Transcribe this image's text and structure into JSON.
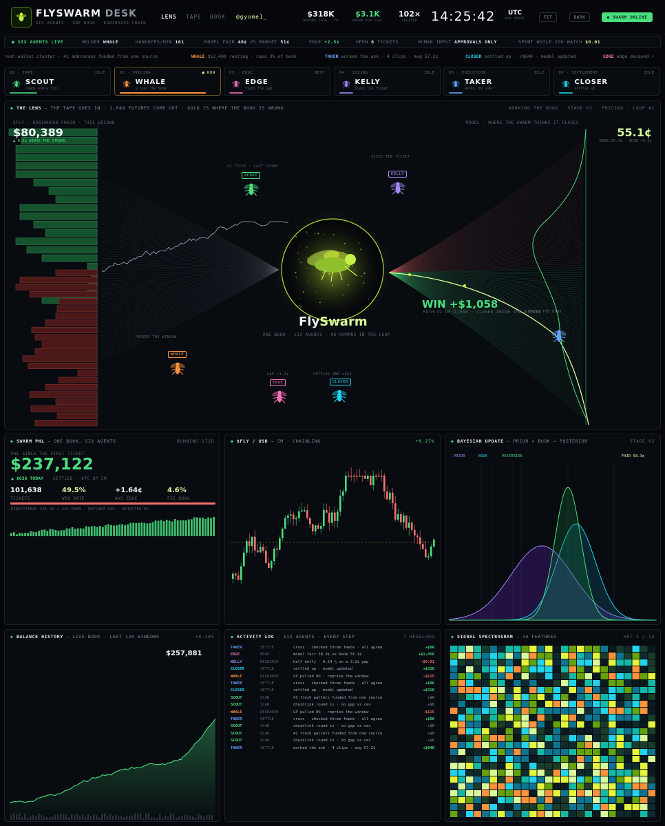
{
  "header": {
    "brand_main": "FLYSWARM",
    "brand_sub": "DESK",
    "tagline": "SIX AGENTS · ONE BOOK · ROBINHOOD CHAIN",
    "nav": [
      "LENS",
      "TAPE",
      "BOOK"
    ],
    "nav_active": "LENS",
    "user": "@gyome1_",
    "stats": [
      {
        "value": "$318K",
        "label": "HUMANS 265% · YR",
        "color": "#f1f4f7"
      },
      {
        "value": "$3.1K",
        "label": "SWARM RUN COST",
        "color": "#4ade80"
      },
      {
        "value": "102×",
        "label": "CHEAPER",
        "color": "#f1f4f7"
      }
    ],
    "clock": "14:25:42",
    "tz": "UTC",
    "tz_sub": "WIN PRIDE",
    "buttons": {
      "fit": "FIT",
      "dark": "DARK",
      "online": "● SWARM ONLINE"
    }
  },
  "status_bar": {
    "live": "● SIX AGENTS LIVE",
    "holder_label": "HOLDER",
    "holder_value": "WHALE",
    "handoffs_label": "HANDOFFS/MIN",
    "handoffs_value": "161",
    "fair_label": "MODEL FAIR",
    "fair_value": "48¢",
    "vs": "VS MARKET",
    "market_value": "51¢",
    "edge_label": "EDGE",
    "edge_value": "+2.5¢",
    "open_label": "OPEN",
    "open_value": "6",
    "open_suffix": "TICKETS",
    "human_label": "HUMAN INPUT",
    "human_value": "APPROVALS ONLY",
    "spent_label": "SPENT WHILE YOU WATCH",
    "spent_value": "$0.01"
  },
  "ticker": [
    {
      "tag": "",
      "text": "resh wallet cluster · 41 addresses funded from one source",
      "color": "#6b7580"
    },
    {
      "tag": "WHALE",
      "text": "$12,400 resting · caps 3% of book",
      "color": "#fb923c"
    },
    {
      "tag": "TAKER",
      "text": "worked the ask · 4 clips · avg 57.2¢",
      "color": "#60a5fa"
    },
    {
      "tag": "CLOSER",
      "text": "settled up · +$640 · model updated",
      "color": "#22d3ee"
    },
    {
      "tag": "EDGE",
      "text": "edge decayed +",
      "color": "#f472b6"
    }
  ],
  "stages": [
    {
      "num": "01 · TAPE",
      "status": "IDLE",
      "name": "SCOUT",
      "desc": "reads every fill",
      "color": "#4ade80",
      "icon": "scout-fly-icon"
    },
    {
      "num": "02 · PRICING",
      "status": "● RUN",
      "name": "WHALE",
      "desc": "prices the book",
      "color": "#fb923c",
      "icon": "whale-fly-icon"
    },
    {
      "num": "03 · EDGE",
      "status": "NEXT",
      "name": "EDGE",
      "desc": "finds the gap",
      "color": "#f472b6",
      "icon": "edge-fly-icon"
    },
    {
      "num": "04 · SIZING",
      "status": "IDLE",
      "name": "KELLY",
      "desc": "sizes the ticket",
      "color": "#a78bfa",
      "icon": "kelly-fly-icon"
    },
    {
      "num": "05 · EXECUTION",
      "status": "IDLE",
      "name": "TAKER",
      "desc": "works the ask",
      "color": "#60a5fa",
      "icon": "taker-fly-icon"
    },
    {
      "num": "06 · SETTLEMENT",
      "status": "IDLE",
      "name": "CLOSER",
      "desc": "settles up",
      "color": "#22d3ee",
      "icon": "closer-fly-icon"
    }
  ],
  "lens": {
    "title": "THE LENS",
    "subtitle": "— THE TAPE GOES IN · 2,048 FUTURES COME OUT · GOLD IS WHERE THE BOOK IS WRONG",
    "status": "WORKING THE BOOK · STAGE 02 · PRICING · LOOP #2",
    "price_label": "$FLY · ROBINHOOD CHAIN · THIS SECOND",
    "price": "$80,389",
    "price_sub": "▲ 0.5¢ ABOVE THE STRIKE",
    "model_label": "MODEL · WHERE THE SWARM THINKS IT CLOSES",
    "model_value": "55.1¢",
    "model_sub": "BOOK 55.1¢ · EDGE +3.2¢",
    "center_title_a": "Fly",
    "center_title_b": "Swarm",
    "center_sub": "ONE BOOK · SIX AGENTS · 96 HUMANS IN THE LOOP",
    "win": "WIN +$1,058",
    "win_sub": "PATH 41 OF 2,048 · CLOSED ABOVE THE STRIKE",
    "flies": [
      {
        "tag": "SCOUT",
        "caption": "41 TICKS · LAST STORE",
        "color": "#4ade80"
      },
      {
        "tag": "KELLY",
        "caption": "SIZES THE TICKET",
        "color": "#a78bfa"
      },
      {
        "tag": "WHALE",
        "caption": "PRICES THE WINDOW",
        "color": "#fb923c"
      },
      {
        "tag": "EDGE",
        "caption": "GAP +3.2¢",
        "color": "#f472b6"
      },
      {
        "tag": "CLOSER",
        "caption": "SETTLES AND LOGS",
        "color": "#22d3ee"
      },
      {
        "tag": "",
        "caption": "WORKS THE BOOK",
        "color": "#60a5fa"
      }
    ]
  },
  "pnl": {
    "title": "SWARM PNL",
    "subtitle": "— ONE BOOK, SIX AGENTS",
    "status": "RUNNING 171D",
    "since": "PNL SINCE THE FIRST TICKET",
    "value": "$237,122",
    "today": "▲ $636 TODAY",
    "today_sub": "SETTLED · 87C UP 5M",
    "stats": [
      {
        "value": "101,638",
        "label": "TICKETS",
        "color": "#f1f4f7"
      },
      {
        "value": "49.5%",
        "label": "WIN RATE",
        "color": "#d9f99d"
      },
      {
        "value": "+1.64¢",
        "label": "AVG EDGE",
        "color": "#f1f4f7"
      },
      {
        "value": "4.6%",
        "label": "FEE DRAG",
        "color": "#d9f99d"
      }
    ],
    "breakdown": "DIRECTIONAL 56% UP / 44% DOWN · MATCHED 92% · REJECTED 8%"
  },
  "fly_chart": {
    "title": "$FLY / USD",
    "subtitle": "— 5M · CHAINLINK",
    "change": "+0.27%"
  },
  "bayes": {
    "title": "BAYESIAN UPDATE",
    "subtitle": "— PRIOR × BOOK → POSTERIOR",
    "status": "STAGE 02",
    "legend": [
      "PRIOR",
      "BOOK",
      "POSTERIOR"
    ],
    "fair": "FAIR 58.3¢"
  },
  "balance": {
    "title": "BALANCE HISTORY",
    "subtitle": "— LIVE BOOK · LAST 120 WINDOWS",
    "change": "+8.38%",
    "value": "$257,881"
  },
  "log": {
    "title": "ACTIVITY LOG",
    "subtitle": "— SIX AGENTS · EVERY STEP",
    "status": "7 RESOLVED",
    "rows": [
      {
        "agent": "TAKER",
        "act": "SETTLE",
        "msg": "cross · checked three feeds · all agree",
        "val": "+$96",
        "c": "#60a5fa",
        "vc": "#4ade80"
      },
      {
        "agent": "EDGE",
        "act": "EDGE",
        "msg": "model fair 58.3¢ vs book 55.1¢",
        "val": "+$1,058",
        "c": "#f472b6",
        "vc": "#4ade80"
      },
      {
        "agent": "KELLY",
        "act": "RESEARCH",
        "msg": "half kelly · 0.24 ⅓ on a 3.2¢ gap",
        "val": "-$0.01",
        "c": "#a78bfa",
        "vc": "#f87171"
      },
      {
        "agent": "CLOSER",
        "act": "SETTLE",
        "msg": "settled up · model updated",
        "val": "+$318",
        "c": "#22d3ee",
        "vc": "#4ade80"
      },
      {
        "agent": "WHALE",
        "act": "RESEARCH",
        "msg": "LP pulled 8% · reprice the window",
        "val": "-$115",
        "c": "#fb923c",
        "vc": "#f87171"
      },
      {
        "agent": "TAKER",
        "act": "SETTLE",
        "msg": "cross · checked three feeds · all agree",
        "val": "+$96",
        "c": "#60a5fa",
        "vc": "#4ade80"
      },
      {
        "agent": "CLOSER",
        "act": "SETTLE",
        "msg": "settled up · model updated",
        "val": "+$318",
        "c": "#22d3ee",
        "vc": "#4ade80"
      },
      {
        "agent": "SCOUT",
        "act": "SCAN",
        "msg": "41 fresh wallets funded from one source",
        "val": "+$0",
        "c": "#4ade80",
        "vc": "#6b7580"
      },
      {
        "agent": "SCOUT",
        "act": "SCAN",
        "msg": "chainlink round in · no gap vs cex",
        "val": "+$0",
        "c": "#4ade80",
        "vc": "#6b7580"
      },
      {
        "agent": "WHALE",
        "act": "RESEARCH",
        "msg": "LP pulled 8% · reprice the window",
        "val": "-$115",
        "c": "#fb923c",
        "vc": "#f87171"
      },
      {
        "agent": "TAKER",
        "act": "SETTLE",
        "msg": "cross · checked three feeds · all agree",
        "val": "+$96",
        "c": "#60a5fa",
        "vc": "#4ade80"
      },
      {
        "agent": "SCOUT",
        "act": "SCAN",
        "msg": "chainlink round in · no gap vs cex",
        "val": "+$0",
        "c": "#4ade80",
        "vc": "#6b7580"
      },
      {
        "agent": "SCOUT",
        "act": "SCAN",
        "msg": "41 fresh wallets funded from one source",
        "val": "+$0",
        "c": "#4ade80",
        "vc": "#6b7580"
      },
      {
        "agent": "SCOUT",
        "act": "SCAN",
        "msg": "chainlink round in · no gap vs cex",
        "val": "+$0",
        "c": "#4ade80",
        "vc": "#6b7580"
      },
      {
        "agent": "TAKER",
        "act": "SETTLE",
        "msg": "worked the ask · 4 clips · avg 57.2¢",
        "val": "+$640",
        "c": "#60a5fa",
        "vc": "#4ade80"
      }
    ]
  },
  "spectro": {
    "title": "SIGNAL SPECTROGRAM",
    "subtitle": "— 14 FEATURES",
    "status": "HOT 3 / 14"
  },
  "colors": {
    "green": "#4ade80",
    "red": "#f87171",
    "lime": "#d9f99d",
    "yellow": "#e4f53b",
    "orange": "#fb923c",
    "pink": "#f472b6",
    "purple": "#a78bfa",
    "blue": "#60a5fa",
    "cyan": "#22d3ee"
  }
}
